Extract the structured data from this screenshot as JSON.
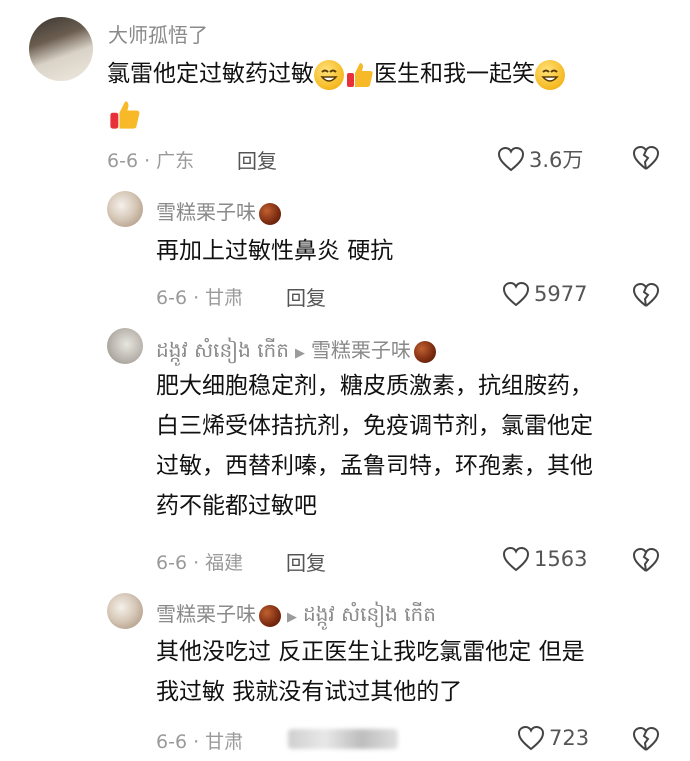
{
  "comments": [
    {
      "username": "大师孤悟了",
      "line1": "氯雷他定过敏药过敏",
      "line1_after": "医生和我一起笑",
      "date_location": "6-6 · 广东",
      "reply_label": "回复",
      "likes": "3.6万"
    },
    {
      "username": "雪糕栗子味",
      "text": "再加上过敏性鼻炎 硬抗",
      "date_location": "6-6 · 甘肃",
      "reply_label": "回复",
      "likes": "5977"
    },
    {
      "username": "ដង្កូវ សំនៀង កើត",
      "reply_to": "雪糕栗子味",
      "lines": [
        "肥大细胞稳定剂，糖皮质激素，抗组胺药，",
        "白三烯受体拮抗剂，免疫调节剂，氯雷他定",
        "过敏，西替利嗪，孟鲁司特，环孢素，其他",
        "药不能都过敏吧"
      ],
      "date_location": "6-6 · 福建",
      "reply_label": "回复",
      "likes": "1563"
    },
    {
      "username": "雪糕栗子味",
      "reply_to": "ដង្កូវ សំនៀង កើត",
      "lines": [
        "其他没吃过 反正医生让我吃氯雷他定 但是",
        "我过敏 我就没有试过其他的了"
      ],
      "date_location": "6-6 · 甘肃",
      "likes": "723"
    }
  ]
}
